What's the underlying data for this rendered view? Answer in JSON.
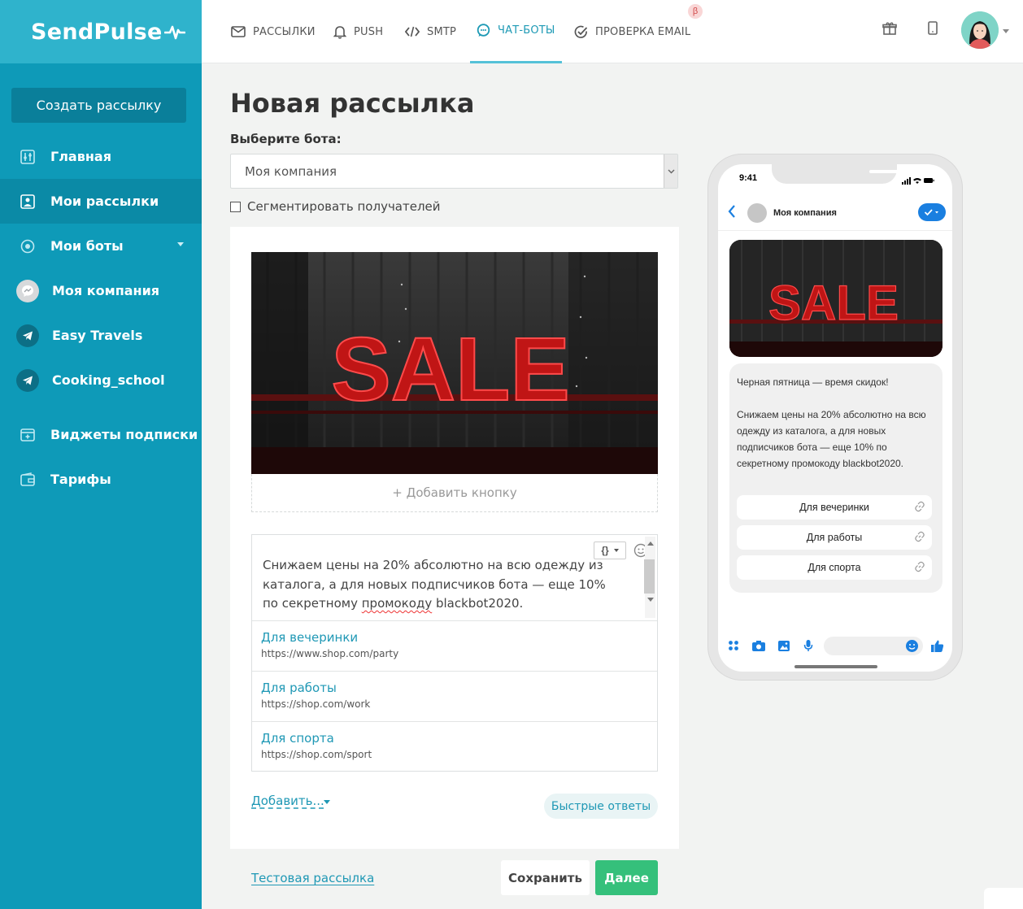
{
  "brand": {
    "name": "SendPulse",
    "accent": "#0e9ab8",
    "green": "#35c07b"
  },
  "sidebar": {
    "create_label": "Создать рассылку",
    "items": [
      {
        "label": "Главная",
        "icon": "dashboard-icon"
      },
      {
        "label": "Мои рассылки",
        "icon": "campaigns-icon",
        "active": true
      },
      {
        "label": "Мои боты",
        "icon": "bots-icon",
        "caret": true
      },
      {
        "label": "Моя компания",
        "icon": "messenger-icon"
      },
      {
        "label": "Easy Travels",
        "icon": "telegram-icon"
      },
      {
        "label": "Cooking_school",
        "icon": "telegram-icon"
      },
      {
        "label": "Виджеты подписки",
        "icon": "widget-icon"
      },
      {
        "label": "Тарифы",
        "icon": "wallet-icon"
      }
    ]
  },
  "topbar": {
    "tabs": [
      {
        "label": "РАССЫЛКИ",
        "icon": "mail-icon"
      },
      {
        "label": "PUSH",
        "icon": "bell-icon"
      },
      {
        "label": "SMTP",
        "icon": "code-icon"
      },
      {
        "label": "ЧАТ-БОТЫ",
        "icon": "chat-icon",
        "active": true
      },
      {
        "label": "ПРОВЕРКА EMAIL",
        "icon": "check-icon"
      }
    ],
    "beta_badge": "β"
  },
  "main": {
    "title": "Новая рассылка",
    "bot_label": "Выберите бота:",
    "bot_value": "Моя компания",
    "segment_label": "Сегментировать получателей",
    "add_button_label": "+ Добавить кнопку",
    "message_pre": "Снижаем цены на 20% абсолютно на всю одежду из каталога, а для новых подписчиков бота — еще 10% по секретному ",
    "message_spell": "промокоду",
    "message_post": " blackbot2020.",
    "buttons": [
      {
        "name": "Для вечеринки",
        "url": "https://www.shop.com/party"
      },
      {
        "name": "Для работы",
        "url": "https://shop.com/work"
      },
      {
        "name": "Для спорта",
        "url": "https://shop.com/sport"
      }
    ],
    "add_more_label": "Добавить...",
    "quick_replies_label": "Быстрые ответы"
  },
  "footer": {
    "test_label": "Тестовая рассылка",
    "save_label": "Сохранить",
    "next_label": "Далее"
  },
  "phone": {
    "time": "9:41",
    "chat_name": "Моя компания",
    "text_heading": "Черная пятница — время скидок!",
    "text_body": "Снижаем цены на 20% абсолютно на всю одежду из каталога, а для новых подписчиков бота — еще 10% по секретному промокоду blackbot2020.",
    "buttons": [
      "Для вечеринки",
      "Для работы",
      "Для спорта"
    ]
  },
  "image": {
    "sign_text": "SALE"
  }
}
